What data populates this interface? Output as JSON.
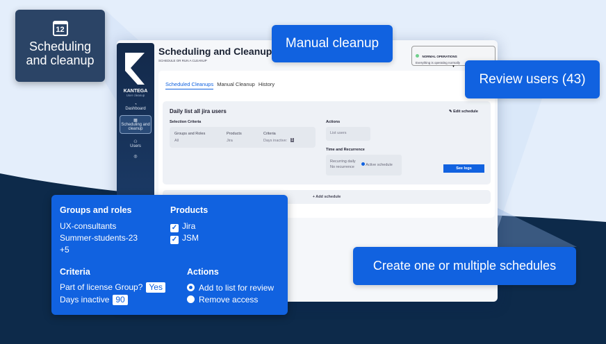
{
  "colors": {
    "accent": "#1162e0",
    "navy": "#0d2a4a",
    "status_ok": "#6fd08c"
  },
  "callouts": {
    "scheduling": {
      "icon": "calendar-icon",
      "day": "12",
      "text": "Scheduling and cleanup"
    },
    "manual": "Manual cleanup",
    "review": "Review users (43)",
    "create": "Create one or multiple schedules"
  },
  "app": {
    "brand": "KANTEGA",
    "brand_sub": "User cleanup",
    "sidebar": [
      {
        "label": "Dashboard",
        "icon": "gauge-icon"
      },
      {
        "label": "Scheduling and cleanup",
        "icon": "calendar-icon",
        "active": true
      },
      {
        "label": "Users",
        "icon": "users-icon"
      },
      {
        "label": "",
        "icon": "coins-icon"
      }
    ],
    "title": "Scheduling and Cleanup",
    "subtitle": "SCHEDULE OR RUN A CLEANUP",
    "status": {
      "title": "NORMAL OPERATIONS",
      "text": "Everything is operating normally"
    },
    "tabs": [
      "Scheduled Cleanups",
      "Manual Cleanup",
      "History"
    ],
    "schedule": {
      "name": "Daily list all jira users",
      "edit": "Edit schedule",
      "selection_label": "Selection Criteria",
      "cols": [
        "Groups and Roles",
        "Products",
        "Criteria"
      ],
      "vals": [
        "All",
        "Jira",
        "Days inactive:"
      ],
      "days": "1",
      "actions_label": "Actions",
      "action": "List users",
      "time_label": "Time and Recurrence",
      "recurring": "Recurring daily",
      "recurrence": "No recurrence",
      "active": "Active schedule",
      "logs": "See logs"
    },
    "add": "+ Add schedule"
  },
  "panel": {
    "groups_title": "Groups and roles",
    "groups": [
      "UX-consultants",
      "Summer-students-23",
      "+5"
    ],
    "products_title": "Products",
    "products": [
      "Jira",
      "JSM"
    ],
    "criteria_title": "Criteria",
    "license": "Part of license Group?",
    "license_val": "Yes",
    "inactive": "Days inactive",
    "inactive_val": "90",
    "actions_title": "Actions",
    "actions": [
      "Add to list for review",
      "Remove access"
    ]
  }
}
